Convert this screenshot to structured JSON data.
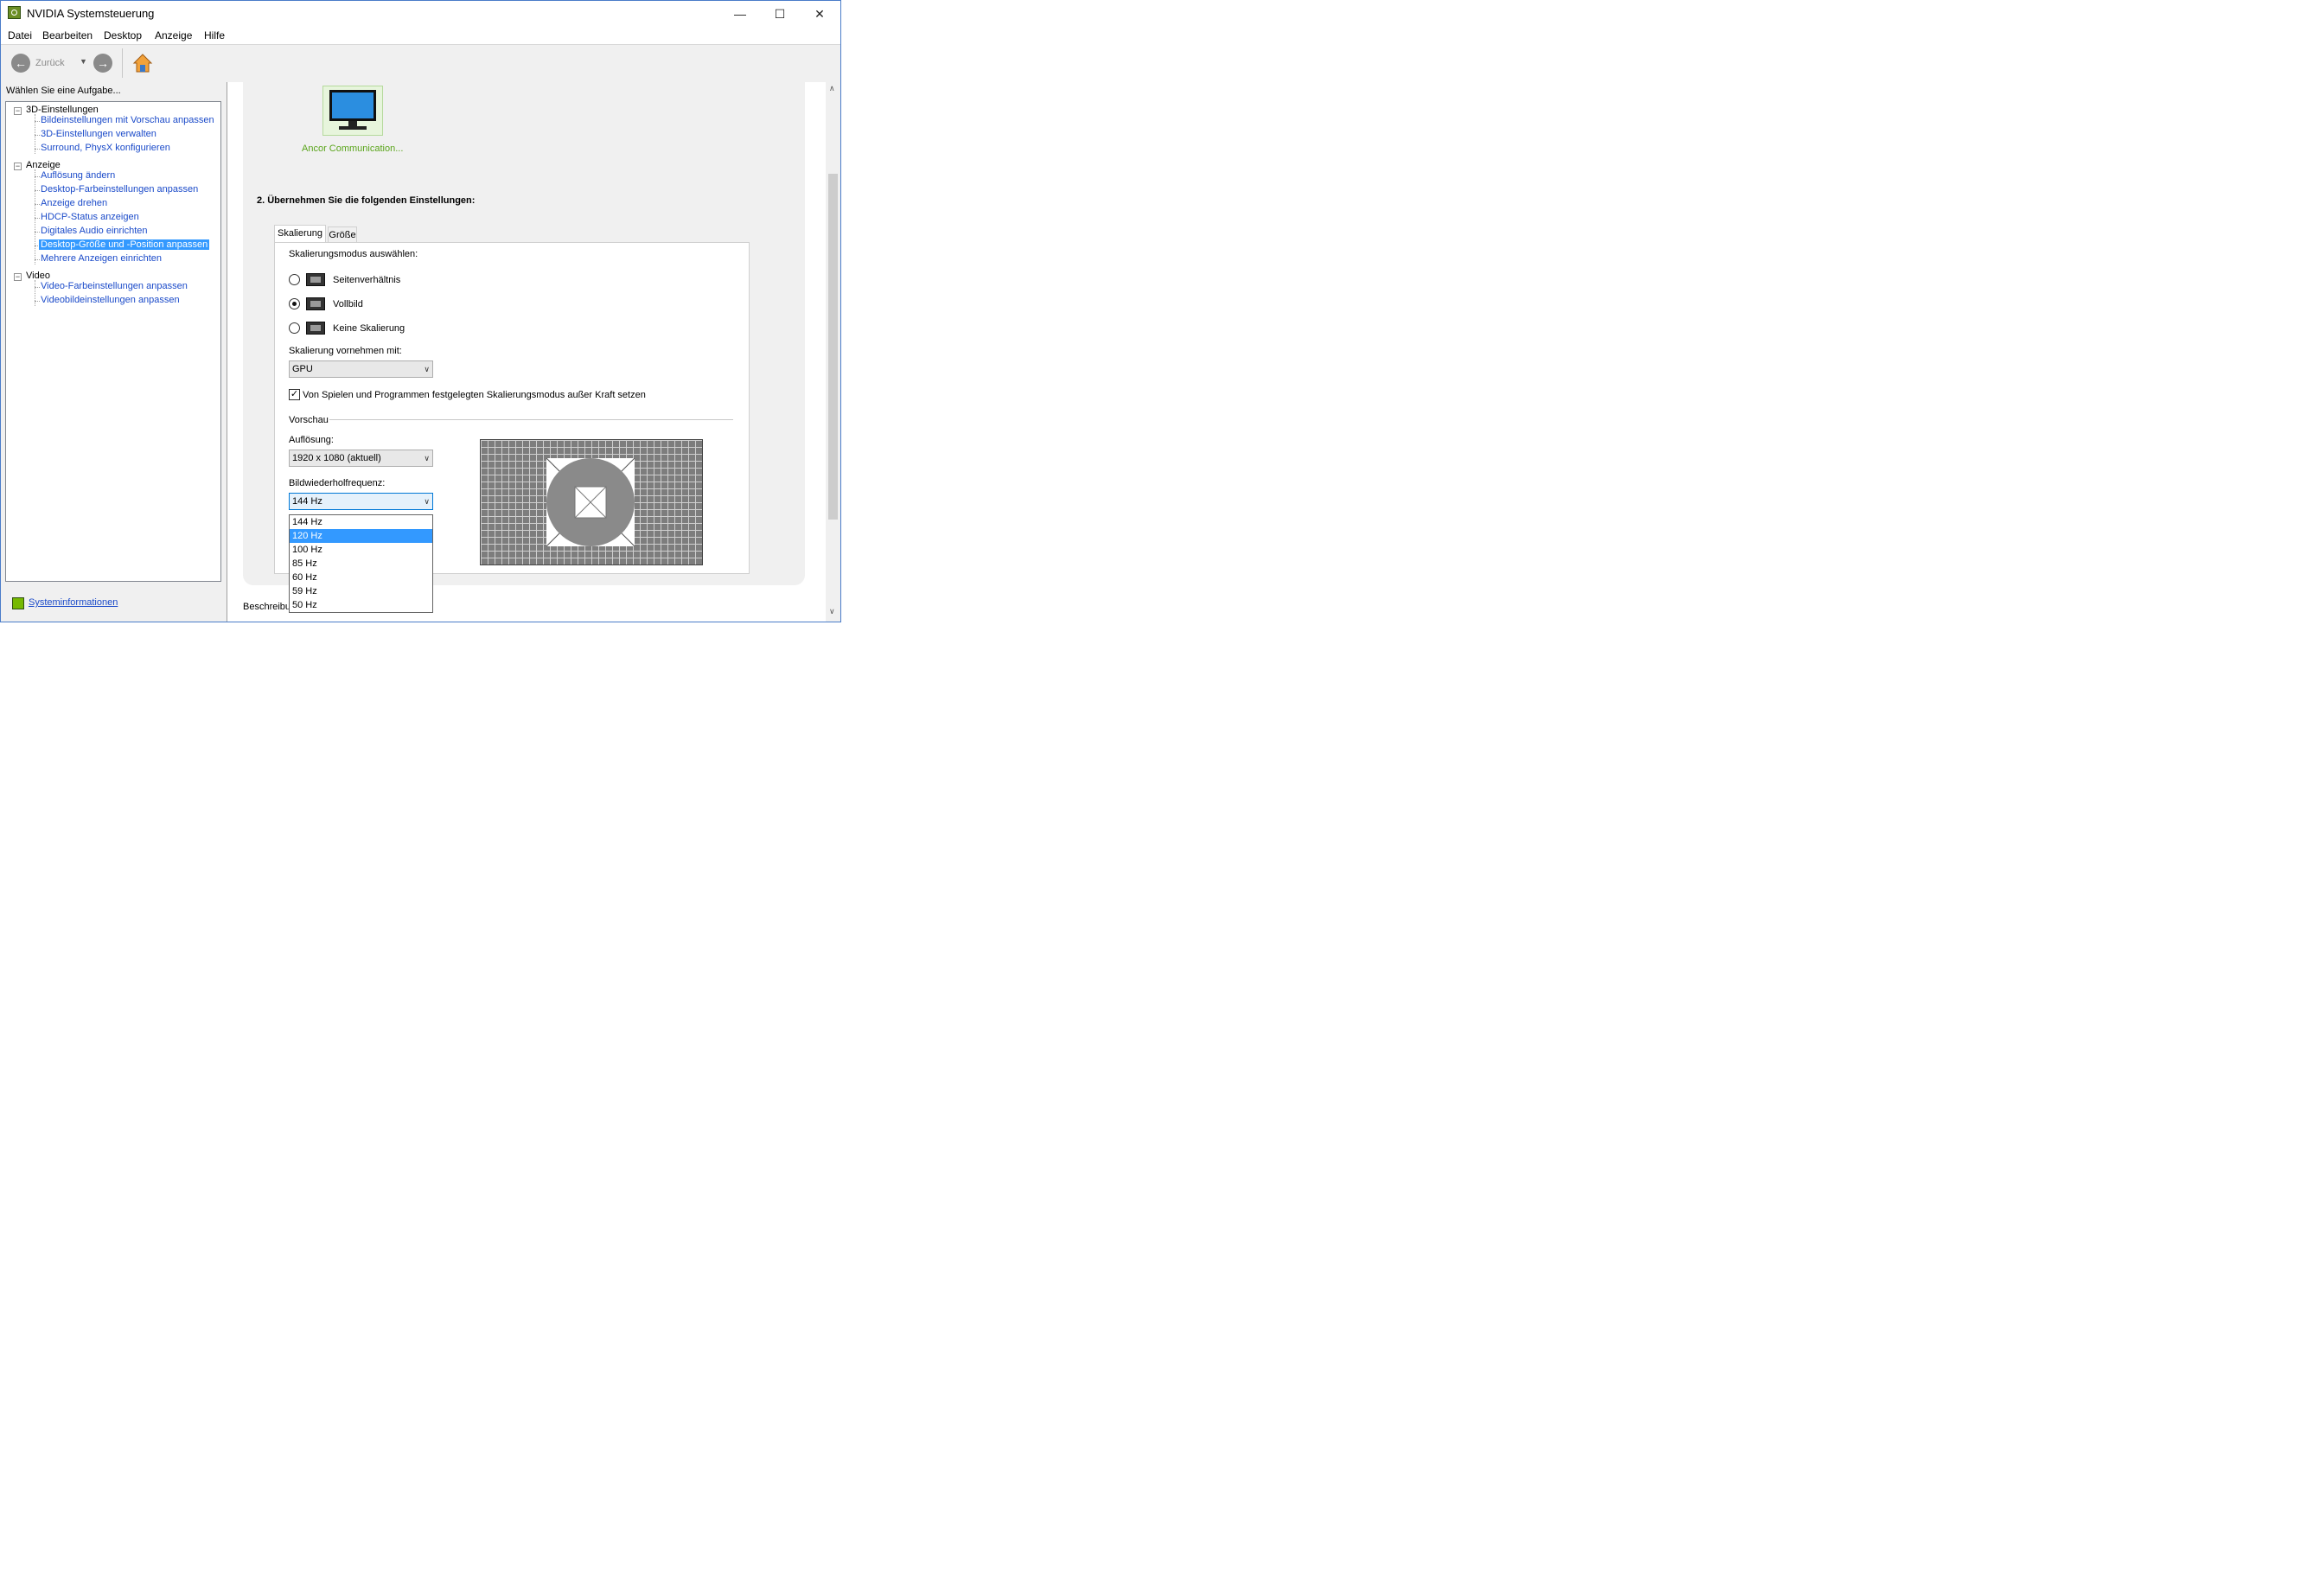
{
  "window": {
    "title": "NVIDIA Systemsteuerung",
    "min": "—",
    "max": "☐",
    "close": "✕"
  },
  "menu": [
    "Datei",
    "Bearbeiten",
    "Desktop",
    "Anzeige",
    "Hilfe"
  ],
  "toolbar": {
    "back_label": "Zurück"
  },
  "sidebar": {
    "task_label": "Wählen Sie eine Aufgabe...",
    "groups": [
      {
        "label": "3D-Einstellungen",
        "items": [
          "Bildeinstellungen mit Vorschau anpassen",
          "3D-Einstellungen verwalten",
          "Surround, PhysX konfigurieren"
        ]
      },
      {
        "label": "Anzeige",
        "items": [
          "Auflösung ändern",
          "Desktop-Farbeinstellungen anpassen",
          "Anzeige drehen",
          "HDCP-Status anzeigen",
          "Digitales Audio einrichten",
          "Desktop-Größe und -Position anpassen",
          "Mehrere Anzeigen einrichten"
        ]
      },
      {
        "label": "Video",
        "items": [
          "Video-Farbeinstellungen anpassen",
          "Videobildeinstellungen anpassen"
        ]
      }
    ],
    "selected": "Desktop-Größe und -Position anpassen",
    "system_info": "Systeminformationen"
  },
  "main": {
    "monitor_label": "Ancor Communication...",
    "section_heading": "2. Übernehmen Sie die folgenden Einstellungen:",
    "tabs": [
      "Skalierung",
      "Größe"
    ],
    "scaling_mode_label": "Skalierungsmodus auswählen:",
    "scaling_modes": [
      "Seitenverhältnis",
      "Vollbild",
      "Keine Skalierung"
    ],
    "selected_mode": "Vollbild",
    "scaling_by_label": "Skalierung vornehmen mit:",
    "scaling_by_value": "GPU",
    "override_checkbox": "Von Spielen und Programmen festgelegten Skalierungsmodus außer Kraft setzen",
    "override_checked": true,
    "preview_label": "Vorschau",
    "resolution_label": "Auflösung:",
    "resolution_value": "1920 x 1080 (aktuell)",
    "refresh_label": "Bildwiederholfrequenz:",
    "refresh_value": "144 Hz",
    "refresh_options": [
      "144 Hz",
      "120 Hz",
      "100 Hz",
      "85 Hz",
      "60 Hz",
      "59 Hz",
      "50 Hz"
    ],
    "refresh_highlighted": "120 Hz",
    "description_label": "Beschreibu"
  },
  "colors": {
    "selection": "#3399ff",
    "link": "#1a4ac9",
    "nvidia_green": "#76b900"
  }
}
